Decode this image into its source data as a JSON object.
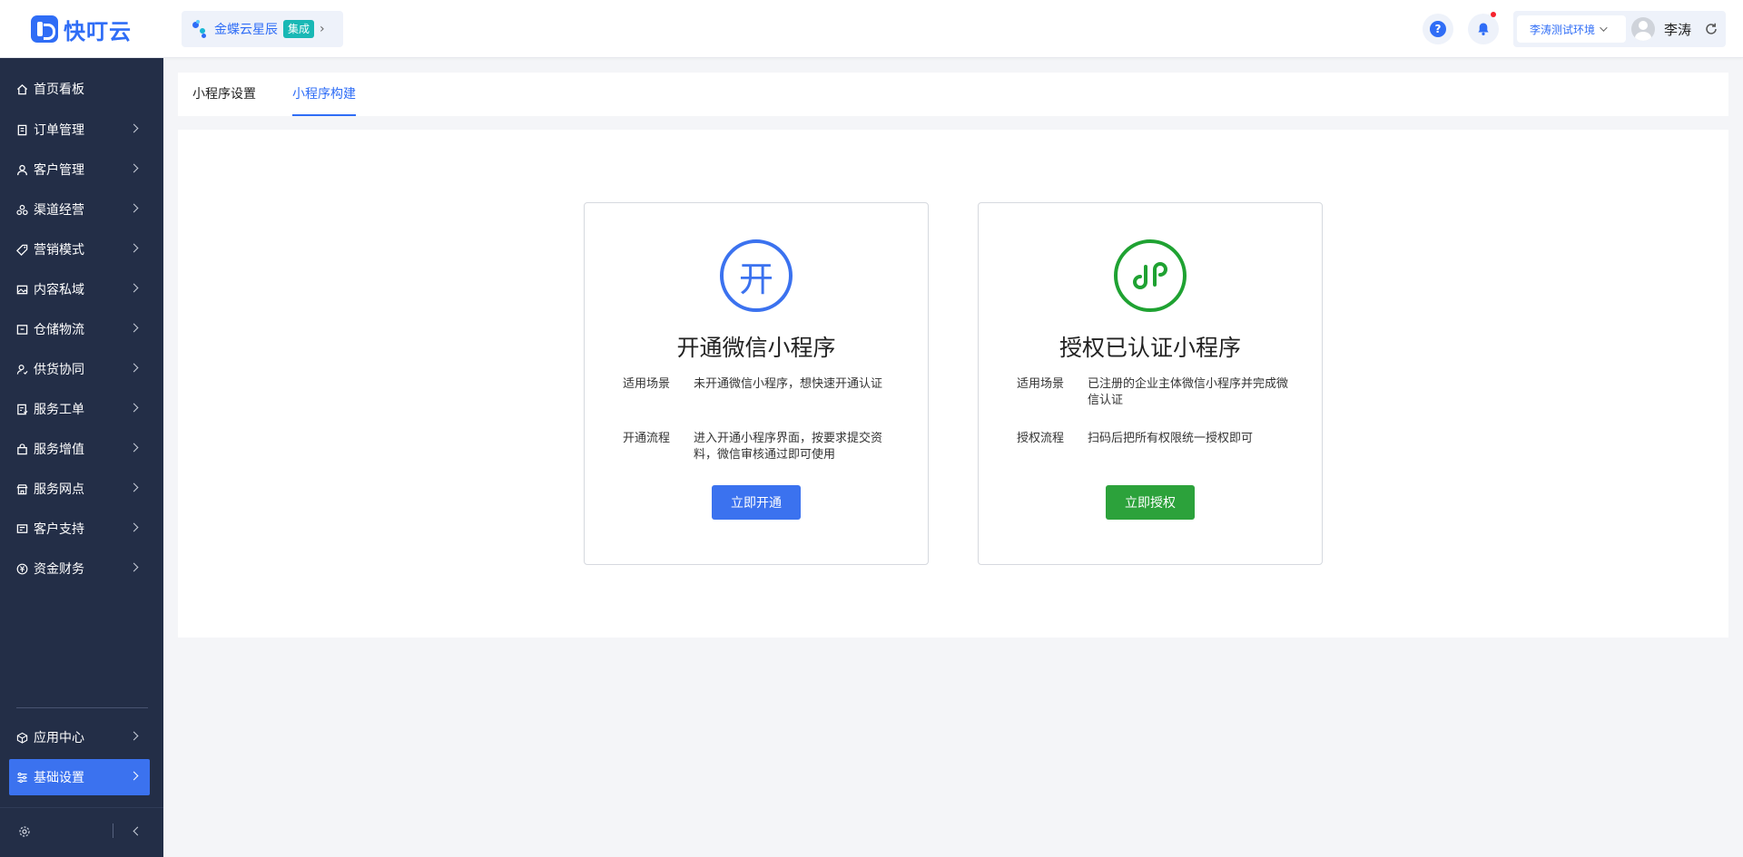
{
  "app": {
    "logo_text": "快叮云",
    "brand_color": "#2f6df6"
  },
  "org": {
    "name": "金蝶云星辰",
    "badge": "集成"
  },
  "user": {
    "env": "李涛测试环境",
    "name": "李涛"
  },
  "sidebar": {
    "items": [
      {
        "label": "首页看板",
        "icon": "home-icon"
      },
      {
        "label": "订单管理",
        "icon": "clipboard-icon"
      },
      {
        "label": "客户管理",
        "icon": "user-icon"
      },
      {
        "label": "渠道经营",
        "icon": "channel-icon"
      },
      {
        "label": "营销模式",
        "icon": "tag-icon"
      },
      {
        "label": "内容私域",
        "icon": "image-icon"
      },
      {
        "label": "仓储物流",
        "icon": "box-icon"
      },
      {
        "label": "供货协同",
        "icon": "supply-icon"
      },
      {
        "label": "服务工单",
        "icon": "ticket-icon"
      },
      {
        "label": "服务增值",
        "icon": "bag-icon"
      },
      {
        "label": "服务网点",
        "icon": "store-icon"
      },
      {
        "label": "客户支持",
        "icon": "support-icon"
      },
      {
        "label": "资金财务",
        "icon": "yuan-icon"
      }
    ],
    "bottom_items": [
      {
        "label": "应用中心",
        "icon": "cube-icon"
      },
      {
        "label": "基础设置",
        "icon": "sliders-icon"
      }
    ]
  },
  "tabs": [
    {
      "label": "小程序设置"
    },
    {
      "label": "小程序构建"
    }
  ],
  "cards": [
    {
      "icon_char": "开",
      "title": "开通微信小程序",
      "rows": [
        {
          "label": "适用场景",
          "value": "未开通微信小程序，想快速开通认证"
        },
        {
          "label": "开通流程",
          "value": "进入开通小程序界面，按要求提交资料，微信审核通过即可使用"
        }
      ],
      "button": "立即开通"
    },
    {
      "title": "授权已认证小程序",
      "rows": [
        {
          "label": "适用场景",
          "value": "已注册的企业主体微信小程序并完成微信认证"
        },
        {
          "label": "授权流程",
          "value": "扫码后把所有权限统一授权即可"
        }
      ],
      "button": "立即授权"
    }
  ]
}
